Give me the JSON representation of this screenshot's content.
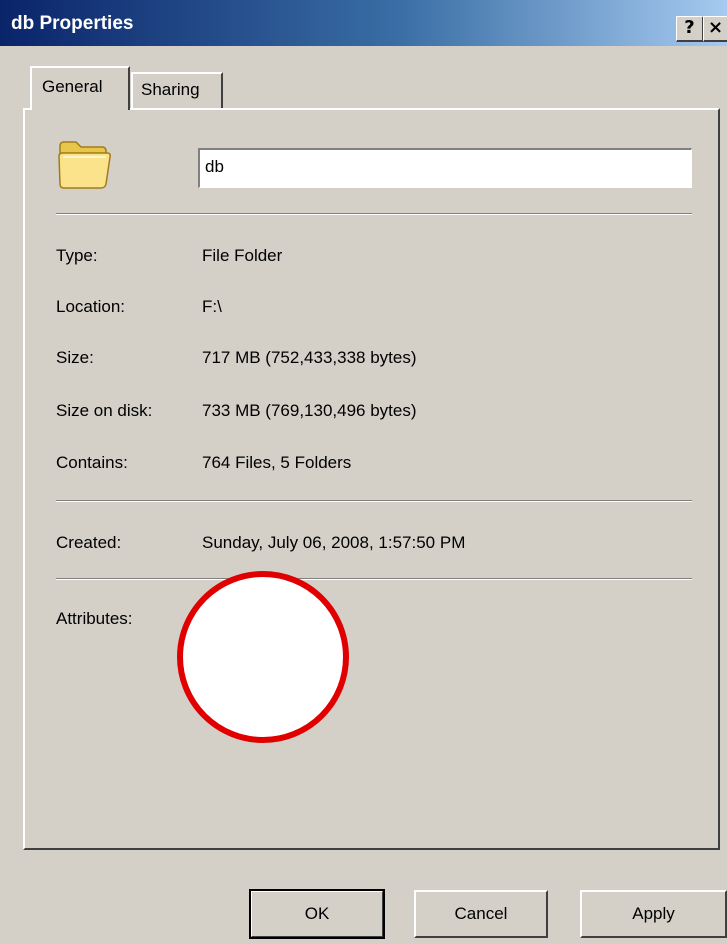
{
  "window": {
    "title": "db Properties",
    "help_label": "?",
    "close_label": "×"
  },
  "tabs": [
    {
      "label": "General"
    },
    {
      "label": "Sharing"
    }
  ],
  "general": {
    "folder_icon": "folder-icon",
    "name_value": "db",
    "properties": [
      {
        "label": "Type:",
        "value": "File Folder"
      },
      {
        "label": "Location:",
        "value": "F:\\"
      },
      {
        "label": "Size:",
        "value": "717 MB (752,433,338 bytes)"
      },
      {
        "label": "Size on disk:",
        "value": "733 MB (769,130,496 bytes)"
      },
      {
        "label": "Contains:",
        "value": "764 Files, 5 Folders"
      }
    ],
    "created": {
      "label": "Created:",
      "value": "Sunday, July 06, 2008, 1:57:50 PM"
    },
    "attributes_label": "Attributes:"
  },
  "buttons": {
    "ok": "OK",
    "cancel": "Cancel",
    "apply": "Apply"
  },
  "colors": {
    "titlebar_start": "#0a246a",
    "titlebar_end": "#a6caf0",
    "dialog_face": "#d4d0c8",
    "annotation": "#e00000"
  }
}
